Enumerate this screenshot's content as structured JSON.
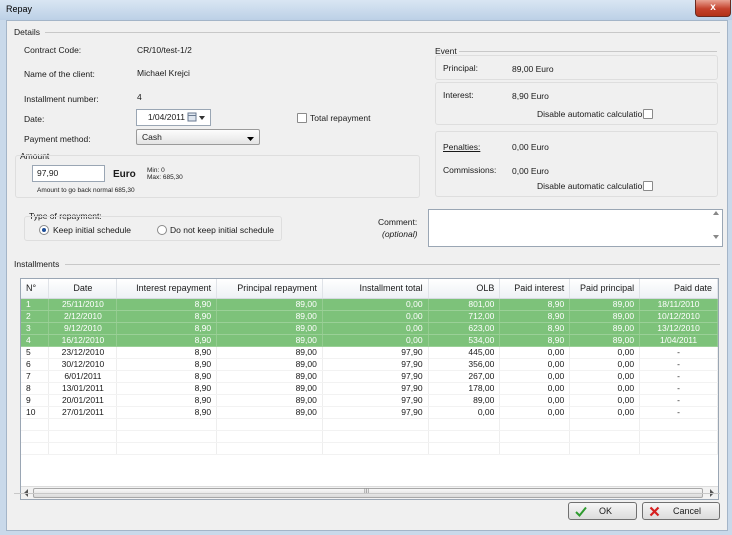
{
  "window": {
    "title": "Repay",
    "close_glyph": "x"
  },
  "details": {
    "legend": "Details",
    "contract_code_label": "Contract Code:",
    "contract_code_value": "CR/10/test-1/2",
    "client_label": "Name of the client:",
    "client_value": "Michael Krejci",
    "installment_number_label": "Installment number:",
    "installment_number_value": "4",
    "date_label": "Date:",
    "date_value": "1/04/2011",
    "total_repayment_label": "Total repayment",
    "payment_method_label": "Payment method:",
    "payment_method_value": "Cash",
    "amount_legend": "Amount",
    "amount_value": "97,90",
    "amount_currency": "Euro",
    "min_text": "Min: 0",
    "max_text": "Max: 685,30",
    "go_back_text": "Amount to go back normal 685,30",
    "type_legend": "Type of repayment:",
    "keep_schedule_label": "Keep initial schedule",
    "not_keep_schedule_label": "Do not keep initial schedule",
    "comment_label": "Comment:",
    "comment_optional": "(optional)",
    "comment_value": ""
  },
  "event": {
    "legend": "Event",
    "principal_label": "Principal:",
    "principal_value": "89,00 Euro",
    "interest_label": "Interest:",
    "interest_value": "8,90 Euro",
    "disable_auto_label_1": "Disable automatic calculation",
    "penalties_label": "Penalties:",
    "penalties_value": "0,00 Euro",
    "commissions_label": "Commissions:",
    "commissions_value": "0,00 Euro",
    "disable_auto_label_2": "Disable automatic calculation"
  },
  "installments": {
    "legend": "Installments",
    "columns": [
      "N°",
      "Date",
      "Interest repayment",
      "Principal repayment",
      "Installment total",
      "OLB",
      "Paid interest",
      "Paid principal",
      "Paid date"
    ],
    "rows": [
      {
        "paid": true,
        "cells": [
          "1",
          "25/11/2010",
          "8,90",
          "89,00",
          "0,00",
          "801,00",
          "8,90",
          "89,00",
          "18/11/2010"
        ]
      },
      {
        "paid": true,
        "cells": [
          "2",
          "2/12/2010",
          "8,90",
          "89,00",
          "0,00",
          "712,00",
          "8,90",
          "89,00",
          "10/12/2010"
        ]
      },
      {
        "paid": true,
        "cells": [
          "3",
          "9/12/2010",
          "8,90",
          "89,00",
          "0,00",
          "623,00",
          "8,90",
          "89,00",
          "13/12/2010"
        ]
      },
      {
        "paid": true,
        "cells": [
          "4",
          "16/12/2010",
          "8,90",
          "89,00",
          "0,00",
          "534,00",
          "8,90",
          "89,00",
          "1/04/2011"
        ]
      },
      {
        "paid": false,
        "cells": [
          "5",
          "23/12/2010",
          "8,90",
          "89,00",
          "97,90",
          "445,00",
          "0,00",
          "0,00",
          "-"
        ]
      },
      {
        "paid": false,
        "cells": [
          "6",
          "30/12/2010",
          "8,90",
          "89,00",
          "97,90",
          "356,00",
          "0,00",
          "0,00",
          "-"
        ]
      },
      {
        "paid": false,
        "cells": [
          "7",
          "6/01/2011",
          "8,90",
          "89,00",
          "97,90",
          "267,00",
          "0,00",
          "0,00",
          "-"
        ]
      },
      {
        "paid": false,
        "cells": [
          "8",
          "13/01/2011",
          "8,90",
          "89,00",
          "97,90",
          "178,00",
          "0,00",
          "0,00",
          "-"
        ]
      },
      {
        "paid": false,
        "cells": [
          "9",
          "20/01/2011",
          "8,90",
          "89,00",
          "97,90",
          "89,00",
          "0,00",
          "0,00",
          "-"
        ]
      },
      {
        "paid": false,
        "cells": [
          "10",
          "27/01/2011",
          "8,90",
          "89,00",
          "97,90",
          "0,00",
          "0,00",
          "0,00",
          "-"
        ]
      }
    ],
    "empty_rows": 3,
    "scroll_thumb_glyph": "III"
  },
  "buttons": {
    "ok_label": "OK",
    "cancel_label": "Cancel"
  },
  "colors": {
    "paid_row": "#7dc27a",
    "ok_icon": "#2e9b2e",
    "cancel_icon": "#d62020"
  },
  "icons": [
    "calendar-icon",
    "chevron-down-icon",
    "check-icon",
    "cross-icon",
    "arrow-left-icon",
    "arrow-right-icon",
    "arrow-up-icon",
    "arrow-down-icon"
  ]
}
